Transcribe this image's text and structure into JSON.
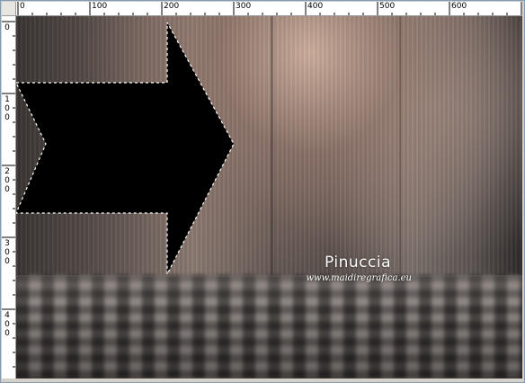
{
  "ruler": {
    "horizontal_labels": [
      "0",
      "100",
      "200",
      "300",
      "400",
      "500",
      "600"
    ],
    "vertical_labels": [
      "0",
      "100",
      "200",
      "300",
      "400"
    ]
  },
  "watermark": {
    "name": "Pinuccia",
    "site": "www.maidiregrafica.eu"
  },
  "selection": {
    "shape": "arrow-right",
    "fill_color": "#000000",
    "outline": "marching-ants"
  },
  "colors": {
    "ruler_bg": "#ffffff",
    "frame_border": "#7f9db9",
    "canvas_warm": "#d2b2a0"
  }
}
